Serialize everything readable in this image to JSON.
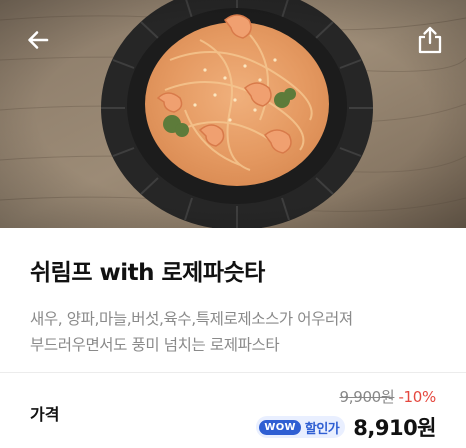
{
  "product": {
    "title": "쉬림프 with 로제파슷타",
    "description": "새우, 양파,마늘,버섯,육수,특제로제소스가 어우러져\n부드러우면서도 풍미 넘치는 로제파스타",
    "image_alt": "shrimp rose pasta on dark ribbed plate"
  },
  "nav": {
    "back_icon": "arrow-left-icon",
    "share_icon": "share-icon"
  },
  "price": {
    "label": "가격",
    "original": "9,900원",
    "discount": "-10%",
    "badge_wow": "WOW",
    "badge_label": "할인가",
    "sale": "8,910원"
  },
  "colors": {
    "discount": "#e5483f",
    "wow_badge": "#2f5fd3",
    "wow_badge_bg": "#e9efff",
    "description": "#8a8a8a"
  }
}
